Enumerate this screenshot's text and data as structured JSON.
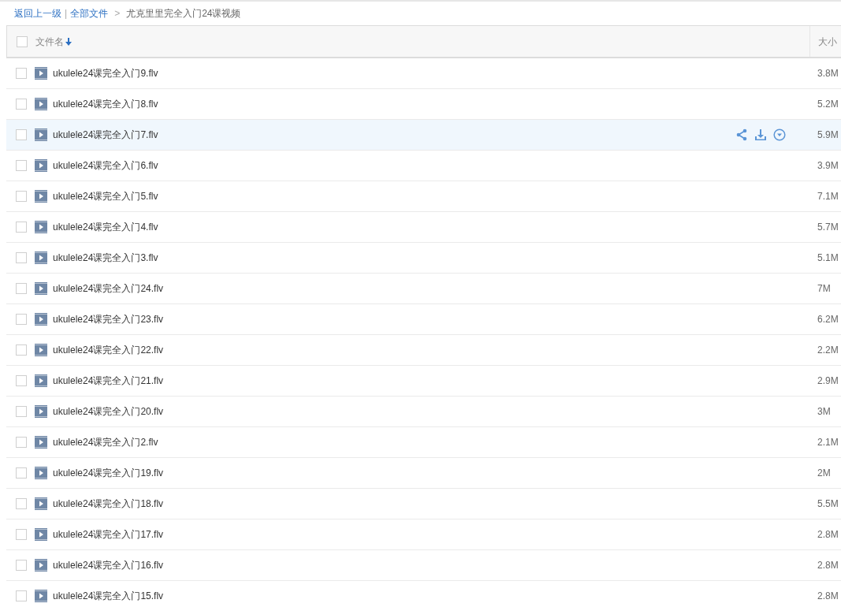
{
  "breadcrumb": {
    "back": "返回上一级",
    "separator": "|",
    "root": "全部文件",
    "arrow": ">",
    "current": "尤克里里完全入门24课视频"
  },
  "table": {
    "select_all": {
      "checked": false
    },
    "columns": [
      {
        "label": "文件名",
        "sorted": true
      },
      {
        "label": "大小",
        "sorted": false
      }
    ],
    "rows": [
      {
        "name": "ukulele24课完全入门9.flv",
        "size": "3.8M",
        "hovered": false,
        "checked": false
      },
      {
        "name": "ukulele24课完全入门8.flv",
        "size": "5.2M",
        "hovered": false,
        "checked": false
      },
      {
        "name": "ukulele24课完全入门7.flv",
        "size": "5.9M",
        "hovered": true,
        "checked": false
      },
      {
        "name": "ukulele24课完全入门6.flv",
        "size": "3.9M",
        "hovered": false,
        "checked": false
      },
      {
        "name": "ukulele24课完全入门5.flv",
        "size": "7.1M",
        "hovered": false,
        "checked": false
      },
      {
        "name": "ukulele24课完全入门4.flv",
        "size": "5.7M",
        "hovered": false,
        "checked": false
      },
      {
        "name": "ukulele24课完全入门3.flv",
        "size": "5.1M",
        "hovered": false,
        "checked": false
      },
      {
        "name": "ukulele24课完全入门24.flv",
        "size": "7M",
        "hovered": false,
        "checked": false
      },
      {
        "name": "ukulele24课完全入门23.flv",
        "size": "6.2M",
        "hovered": false,
        "checked": false
      },
      {
        "name": "ukulele24课完全入门22.flv",
        "size": "2.2M",
        "hovered": false,
        "checked": false
      },
      {
        "name": "ukulele24课完全入门21.flv",
        "size": "2.9M",
        "hovered": false,
        "checked": false
      },
      {
        "name": "ukulele24课完全入门20.flv",
        "size": "3M",
        "hovered": false,
        "checked": false
      },
      {
        "name": "ukulele24课完全入门2.flv",
        "size": "2.1M",
        "hovered": false,
        "checked": false
      },
      {
        "name": "ukulele24课完全入门19.flv",
        "size": "2M",
        "hovered": false,
        "checked": false
      },
      {
        "name": "ukulele24课完全入门18.flv",
        "size": "5.5M",
        "hovered": false,
        "checked": false
      },
      {
        "name": "ukulele24课完全入门17.flv",
        "size": "2.8M",
        "hovered": false,
        "checked": false
      },
      {
        "name": "ukulele24课完全入门16.flv",
        "size": "2.8M",
        "hovered": false,
        "checked": false
      },
      {
        "name": "ukulele24课完全入门15.flv",
        "size": "2.8M",
        "hovered": false,
        "checked": false
      }
    ]
  }
}
